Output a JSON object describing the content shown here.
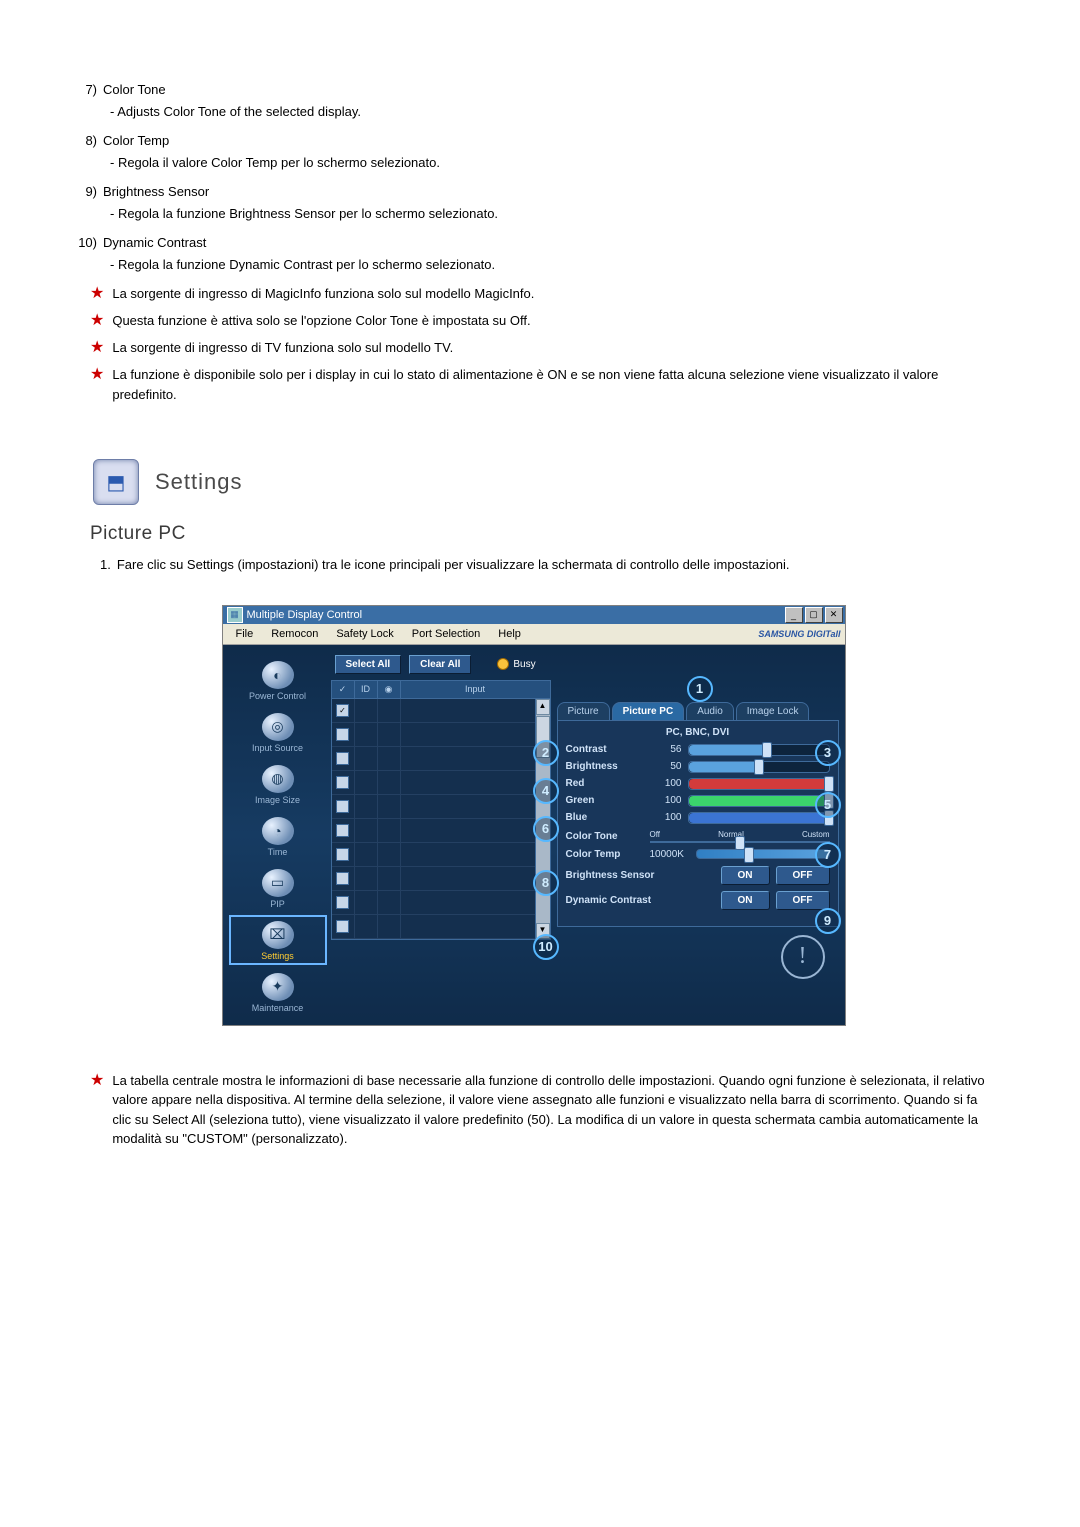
{
  "list": [
    {
      "num": "7)",
      "title": "Color Tone",
      "desc": "- Adjusts Color Tone of the selected display."
    },
    {
      "num": "8)",
      "title": "Color Temp",
      "desc": "- Regola il valore Color Temp per lo schermo selezionato."
    },
    {
      "num": "9)",
      "title": "Brightness Sensor",
      "desc": "- Regola la funzione Brightness Sensor per lo schermo selezionato."
    },
    {
      "num": "10)",
      "title": "Dynamic Contrast",
      "desc": "- Regola la funzione Dynamic Contrast per lo schermo selezionato."
    }
  ],
  "stars": [
    "La sorgente di ingresso di MagicInfo funziona solo sul modello MagicInfo.",
    "Questa funzione è attiva solo se l'opzione Color Tone è impostata su Off.",
    "La sorgente di ingresso di TV funziona solo sul modello TV.",
    "La funzione è disponibile solo per i display in cui lo stato di alimentazione è ON e se non viene fatta alcuna selezione viene visualizzato il valore predefinito."
  ],
  "settings_header": "Settings",
  "subsection": "Picture PC",
  "numbered_step": {
    "num": "1.",
    "text": "Fare clic su Settings (impostazioni) tra le icone principali per visualizzare la schermata di controllo delle impostazioni."
  },
  "window": {
    "title": "Multiple Display Control",
    "menus": [
      "File",
      "Remocon",
      "Safety Lock",
      "Port Selection",
      "Help"
    ],
    "brand": "SAMSUNG DIGITall",
    "sidebar": [
      {
        "label": "Power Control",
        "glyph": "◐"
      },
      {
        "label": "Input Source",
        "glyph": "◎"
      },
      {
        "label": "Image Size",
        "glyph": "◍"
      },
      {
        "label": "Time",
        "glyph": "◔"
      },
      {
        "label": "PIP",
        "glyph": "▭"
      },
      {
        "label": "Settings",
        "glyph": "⌧",
        "active": true
      },
      {
        "label": "Maintenance",
        "glyph": "✦"
      }
    ],
    "top_buttons": {
      "select_all": "Select All",
      "clear_all": "Clear All",
      "busy": "Busy"
    },
    "grid": {
      "chk": "✓",
      "id": "ID",
      "status": "◉",
      "input": "Input",
      "row_count": 10
    },
    "tabs": [
      "Picture",
      "Picture PC",
      "Audio",
      "Image Lock"
    ],
    "active_tab": 1,
    "mode_text": "PC, BNC, DVI",
    "sliders": [
      {
        "label": "Contrast",
        "value": 56,
        "pct": 56,
        "color": "#5aa2de"
      },
      {
        "label": "Brightness",
        "value": 50,
        "pct": 50,
        "color": "#5aa2de"
      },
      {
        "label": "Red",
        "value": 100,
        "pct": 100,
        "color": "#d33b3b"
      },
      {
        "label": "Green",
        "value": 100,
        "pct": 100,
        "color": "#3bd36c"
      },
      {
        "label": "Blue",
        "value": 100,
        "pct": 100,
        "color": "#3b74d3"
      }
    ],
    "color_tone": {
      "label": "Color Tone",
      "marks": [
        "Off",
        "Normal",
        "Custom"
      ],
      "pos_pct": 50
    },
    "color_temp": {
      "label": "Color Temp",
      "value_text": "10000K",
      "pos_pct": 40
    },
    "brightness_sensor": {
      "label": "Brightness Sensor",
      "on": "ON",
      "off": "OFF"
    },
    "dynamic_contrast": {
      "label": "Dynamic Contrast",
      "on": "ON",
      "off": "OFF"
    },
    "markers": [
      "1",
      "2",
      "3",
      "4",
      "5",
      "6",
      "7",
      "8",
      "9",
      "10"
    ]
  },
  "final_note": "La tabella centrale mostra le informazioni di base necessarie alla funzione di controllo delle impostazioni. Quando ogni funzione è selezionata, il relativo valore appare nella dispositiva. Al termine della selezione, il valore viene assegnato alle funzioni e visualizzato nella barra di scorrimento. Quando si fa clic su Select All (seleziona tutto), viene visualizzato il valore predefinito (50). La modifica di un valore in questa schermata cambia automaticamente la modalità su \"CUSTOM\" (personalizzato)."
}
